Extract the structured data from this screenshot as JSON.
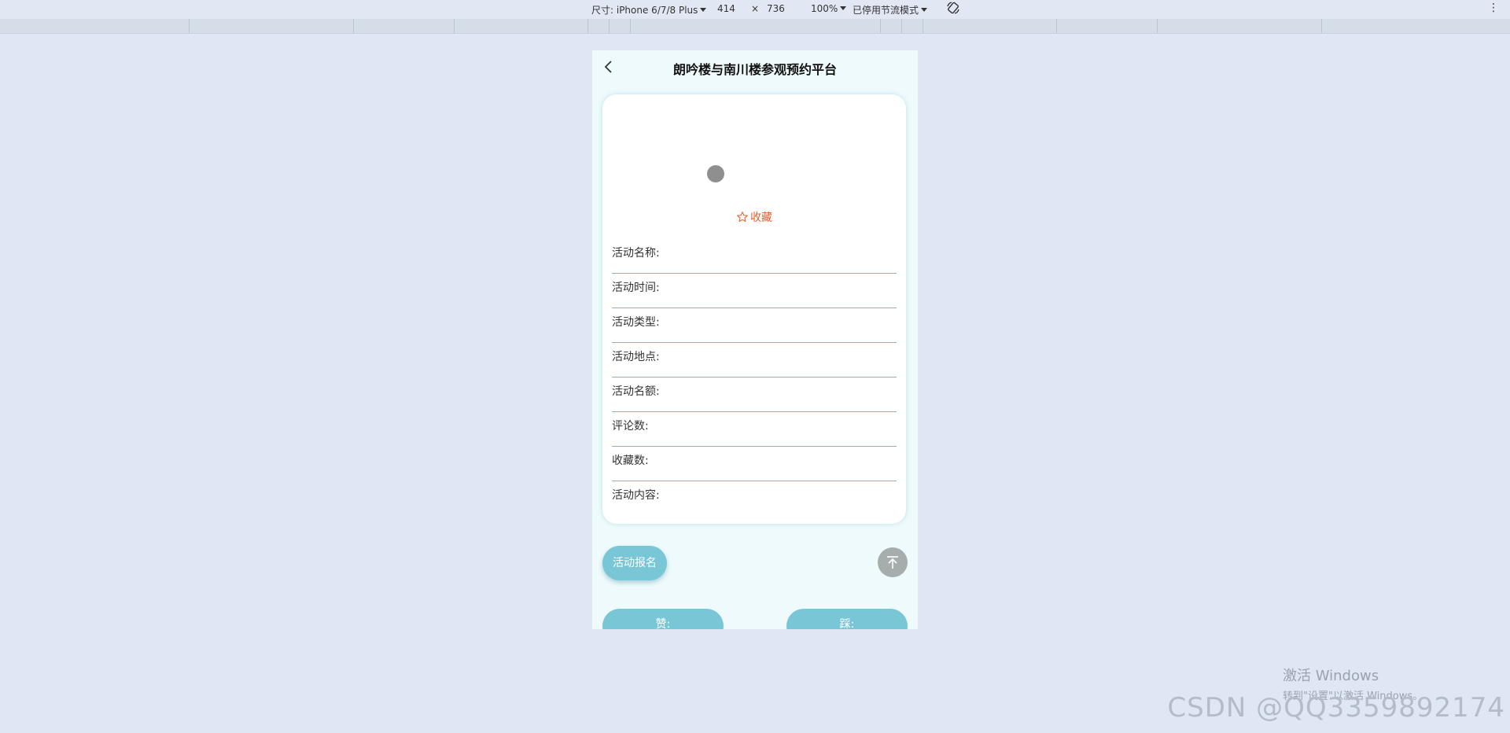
{
  "devtools": {
    "device_label": "尺寸: iPhone 6/7/8 Plus",
    "width": "414",
    "times": "×",
    "height": "736",
    "zoom": "100%",
    "throttle": "已停用节流模式"
  },
  "page": {
    "title": "朗吟楼与南川楼参观预约平台",
    "favorite_label": "收藏",
    "fields": [
      {
        "label": "活动名称:"
      },
      {
        "label": "活动时间:"
      },
      {
        "label": "活动类型:"
      },
      {
        "label": "活动地点:"
      },
      {
        "label": "活动名额:"
      },
      {
        "label": "评论数:"
      },
      {
        "label": "收藏数:"
      },
      {
        "label": "活动内容:"
      }
    ],
    "signup_label": "活动报名",
    "bottom_left_label": "赞:",
    "bottom_right_label": "踩:"
  },
  "watermark": {
    "activate_title": "激活 Windows",
    "activate_sub": "转到\"设置\"以激活 Windows。",
    "csdn": "CSDN @QQ3359892174"
  },
  "colors": {
    "accent": "#79c6d7",
    "favorite": "#e2622e",
    "divider": "#7fb2d9"
  }
}
